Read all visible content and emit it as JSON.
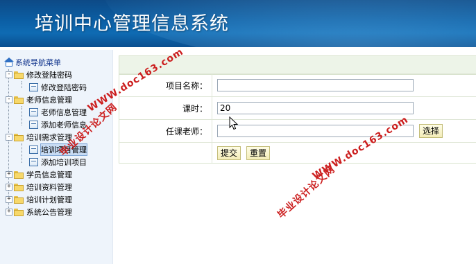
{
  "header": {
    "title": "培训中心管理信息系统"
  },
  "sidebar": {
    "root_label": "系统导航菜单",
    "tree": [
      {
        "label": "修改登陆密码",
        "type": "folder",
        "expander": "-"
      },
      {
        "label": "修改登陆密码",
        "type": "page"
      },
      {
        "label": "老师信息管理",
        "type": "folder",
        "expander": "-"
      },
      {
        "label": "老师信息管理",
        "type": "page"
      },
      {
        "label": "添加老师信息",
        "type": "page"
      },
      {
        "label": "培训需求管理",
        "type": "folder",
        "expander": "-"
      },
      {
        "label": "培训项目管理",
        "type": "page",
        "selected": true
      },
      {
        "label": "添加培训项目",
        "type": "page"
      },
      {
        "label": "学员信息管理",
        "type": "folder",
        "expander": "+"
      },
      {
        "label": "培训资料管理",
        "type": "folder",
        "expander": "+"
      },
      {
        "label": "培训计划管理",
        "type": "folder",
        "expander": "+"
      },
      {
        "label": "系统公告管理",
        "type": "folder",
        "expander": "+"
      }
    ]
  },
  "form": {
    "project_name_label": "项目名称：",
    "project_name_value": "",
    "hours_label": "课时：",
    "hours_value": "20",
    "teacher_label": "任课老师：",
    "teacher_value": "",
    "select_button": "选择",
    "submit_button": "提交",
    "reset_button": "重置"
  },
  "watermarks": {
    "site": "WWW.doc163.com",
    "text": "毕业设计论文网"
  }
}
